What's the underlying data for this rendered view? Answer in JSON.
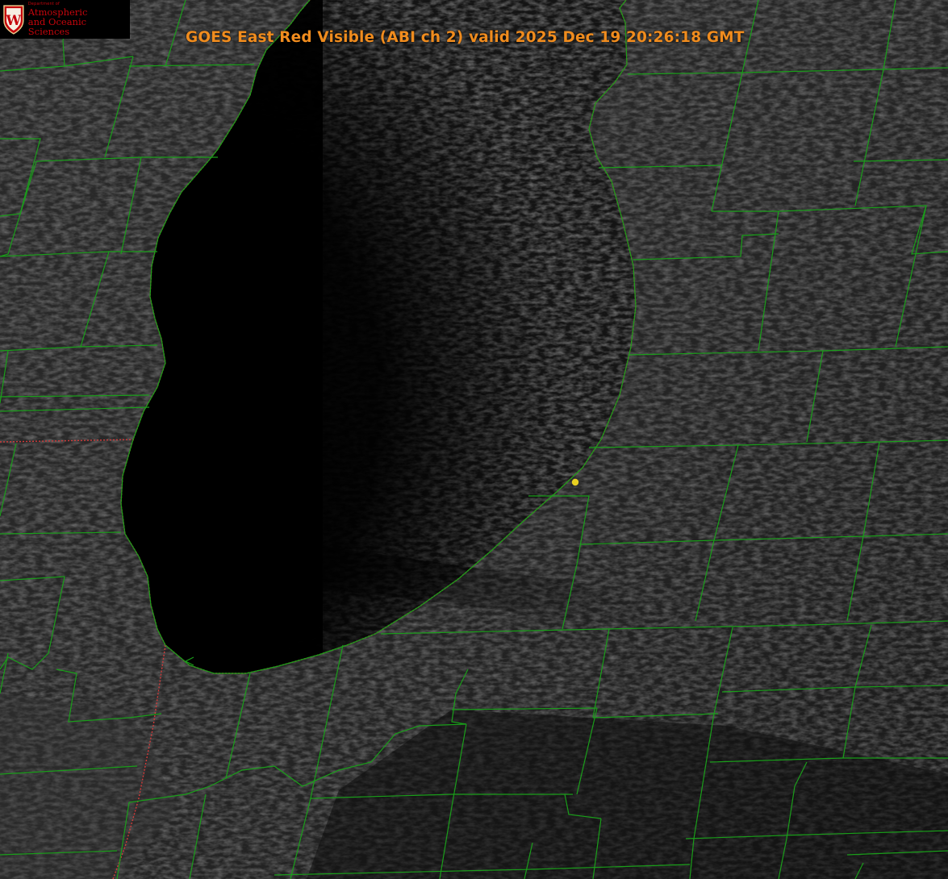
{
  "title": "GOES East Red Visible (ABI ch 2) valid 2025 Dec 19 20:26:18 GMT",
  "logo": {
    "department": "Department of",
    "line1": "Atmospheric",
    "line2": "and Oceanic Sciences",
    "seal_letter": "W"
  },
  "colors": {
    "title": "#f08c1e",
    "county_lines": "#1a9e1a",
    "state_lines": "#d23a3a",
    "marker": "#e8d021",
    "logo": "#c5050c"
  },
  "marker": {
    "label": "station-marker"
  }
}
